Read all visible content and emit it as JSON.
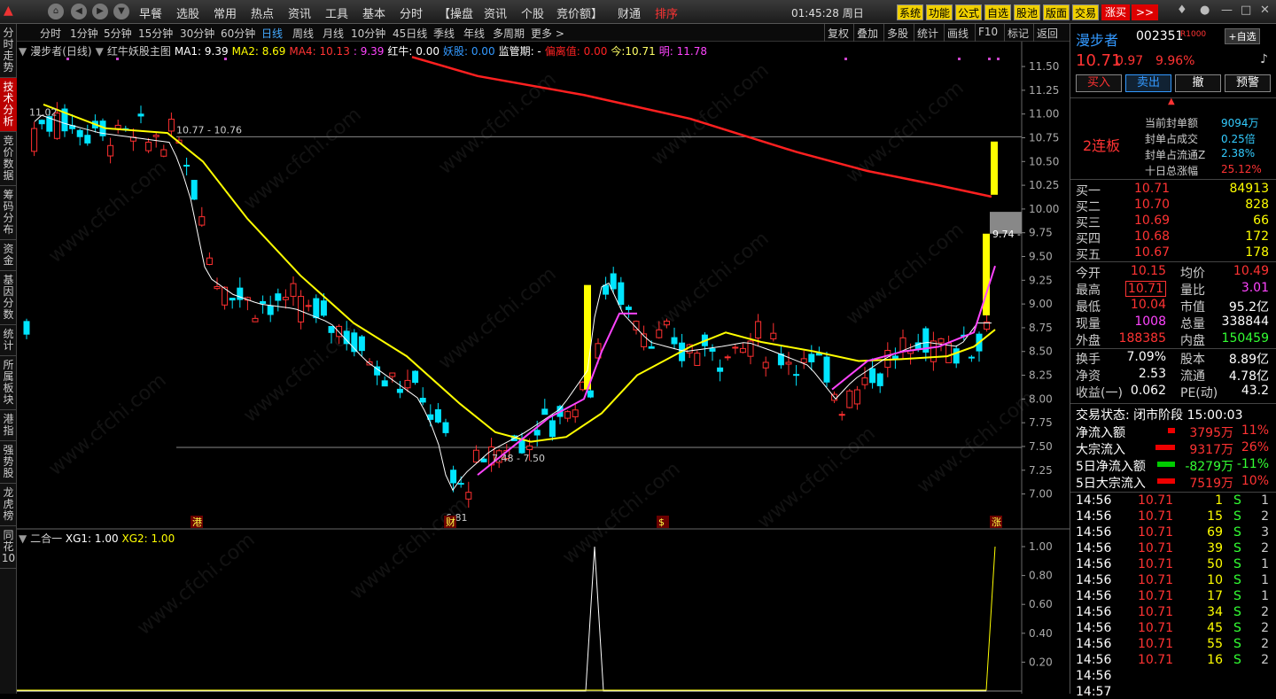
{
  "topbar": {
    "menus": [
      "早餐",
      "选股",
      "常用",
      "热点",
      "资讯",
      "工具",
      "基本",
      "分时",
      "【操盘",
      "资讯",
      "个股",
      "竞价额】",
      "财通",
      "排序"
    ],
    "time": "01:45:28 周日",
    "yellow_buttons": [
      "系统",
      "功能",
      "公式",
      "自选",
      "股池",
      "版面",
      "交易",
      "涨买"
    ],
    "more_button": ">>"
  },
  "leftbar": {
    "tabs": [
      "分时走势",
      "技术分析",
      "竞价数据",
      "筹码分布",
      "资金",
      "基因分数",
      "统计",
      "所属板块",
      "港指",
      "强势股",
      "龙虎榜",
      "同花10"
    ],
    "active_index": 1
  },
  "periods": {
    "items": [
      "分时",
      "1分钟",
      "5分钟",
      "15分钟",
      "30分钟",
      "60分钟",
      "日线",
      "周线",
      "月线",
      "10分钟",
      "45日线",
      "季线",
      "年线",
      "多周期",
      "更多 >"
    ],
    "selected_index": 6,
    "right_items": [
      "复权",
      "叠加",
      "多股",
      "统计",
      "画线",
      "F10",
      "标记",
      "返回"
    ]
  },
  "legend": {
    "title": "漫步者(日线)",
    "indicator": "红牛妖股主图",
    "ma1": "MA1: 9.39",
    "ma2": "MA2: 8.69",
    "ma4": "MA4: 10.13",
    "ma4b": ": 9.39",
    "hongniu": "红牛: 0.00",
    "yaogu": "妖股: 0.00",
    "jianguan": "监管期: -",
    "pianli": "偏离值: 0.00",
    "jin": "今:10.71",
    "ming": "明: 11.78",
    "colors": {
      "ma1": "#ffffff",
      "ma2": "#ffff00",
      "ma4": "#ff3333",
      "ma4b": "#ff44ff",
      "yaogu": "#3399ff",
      "pianli": "#ff2222",
      "jin": "#ffff66",
      "ming": "#ff44ff"
    }
  },
  "sublegend": {
    "name": "二合一",
    "xg1": "XG1: 1.00",
    "xg2": "XG2: 1.00"
  },
  "chart_annotations": {
    "high_label": "11.02",
    "low_label": "6.81",
    "range1": "10.77 - 10.76",
    "range2": "7.48 - 7.50",
    "price_tag": "9.74 -",
    "markers": [
      "港",
      "财",
      "$",
      "涨"
    ]
  },
  "chart_data": [
    {
      "type": "candlestick",
      "title": "漫步者(日线)",
      "y_ticks": [
        "11.50",
        "11.25",
        "11.00",
        "10.75",
        "10.50",
        "10.25",
        "10.00",
        "9.75",
        "9.50",
        "9.25",
        "9.00",
        "8.75",
        "8.50",
        "8.25",
        "8.00",
        "7.75",
        "7.50",
        "7.25",
        "7.00"
      ],
      "ylim": [
        6.8,
        11.65
      ],
      "last_close": 10.71,
      "high": 11.02,
      "low": 6.81,
      "hlines": [
        10.76,
        7.49
      ]
    },
    {
      "type": "line",
      "title": "二合一",
      "y_ticks": [
        "1.00",
        "0.80",
        "0.60",
        "0.40",
        "0.20"
      ],
      "ylim": [
        0,
        1.0
      ]
    }
  ],
  "quote": {
    "name": "漫步者",
    "code": "002351",
    "tag": "R1000",
    "self_select": "+自选",
    "price": "10.71",
    "change": "0.97",
    "pct": "9.96%",
    "buttons": [
      "买入",
      "卖出",
      "撤",
      "预警"
    ],
    "limit_label": "2连板",
    "limit_info": [
      {
        "k": "当前封单额",
        "v": "9094万"
      },
      {
        "k": "封单占成交",
        "v": "0.25倍"
      },
      {
        "k": "封单占流通Z",
        "v": "2.38%"
      },
      {
        "k": "十日总涨幅",
        "v": "25.12%"
      }
    ],
    "bids": [
      {
        "l": "买一",
        "p": "10.71",
        "v": "84913"
      },
      {
        "l": "买二",
        "p": "10.70",
        "v": "828"
      },
      {
        "l": "买三",
        "p": "10.69",
        "v": "66"
      },
      {
        "l": "买四",
        "p": "10.68",
        "v": "172"
      },
      {
        "l": "买五",
        "p": "10.67",
        "v": "178"
      }
    ],
    "stats1": [
      {
        "k1": "今开",
        "v1": "10.15",
        "k2": "均价",
        "v2": "10.49",
        "c1": "#f33",
        "c2": "#f33"
      },
      {
        "k1": "最高",
        "v1": "10.71",
        "k2": "量比",
        "v2": "3.01",
        "c1": "#f33",
        "c2": "#f4f"
      },
      {
        "k1": "最低",
        "v1": "10.04",
        "k2": "市值",
        "v2": "95.2亿",
        "c1": "#f33",
        "c2": "#fff"
      },
      {
        "k1": "现量",
        "v1": "1008",
        "k2": "总量",
        "v2": "338844",
        "c1": "#f4f",
        "c2": "#fff"
      },
      {
        "k1": "外盘",
        "v1": "188385",
        "k2": "内盘",
        "v2": "150459",
        "c1": "#f33",
        "c2": "#3f3"
      }
    ],
    "stats2": [
      {
        "k1": "换手",
        "v1": "7.09%",
        "k2": "股本",
        "v2": "8.89亿"
      },
      {
        "k1": "净资",
        "v1": "2.53",
        "k2": "流通",
        "v2": "4.78亿"
      },
      {
        "k1": "收益(一)",
        "v1": "0.062",
        "k2": "PE(动)",
        "v2": "43.2"
      }
    ],
    "trade_status": "交易状态: 闭市阶段 15:00:03",
    "flows": [
      {
        "k": "净流入额",
        "v": "3795万",
        "p": "11%",
        "c": "#e00",
        "w": 8
      },
      {
        "k": "大宗流入",
        "v": "9317万",
        "p": "26%",
        "c": "#e00",
        "w": 22
      },
      {
        "k": "5日净流入额",
        "v": "-8279万",
        "p": "-11%",
        "c": "#0c0",
        "w": 20
      },
      {
        "k": "5日大宗流入",
        "v": "7519万",
        "p": "10%",
        "c": "#e00",
        "w": 20
      }
    ],
    "ticks": [
      {
        "t": "14:56",
        "p": "10.71",
        "v": "1",
        "s": "S",
        "n": "1"
      },
      {
        "t": "14:56",
        "p": "10.71",
        "v": "15",
        "s": "S",
        "n": "2"
      },
      {
        "t": "14:56",
        "p": "10.71",
        "v": "69",
        "s": "S",
        "n": "3"
      },
      {
        "t": "14:56",
        "p": "10.71",
        "v": "39",
        "s": "S",
        "n": "2"
      },
      {
        "t": "14:56",
        "p": "10.71",
        "v": "50",
        "s": "S",
        "n": "1"
      },
      {
        "t": "14:56",
        "p": "10.71",
        "v": "10",
        "s": "S",
        "n": "1"
      },
      {
        "t": "14:56",
        "p": "10.71",
        "v": "17",
        "s": "S",
        "n": "1"
      },
      {
        "t": "14:56",
        "p": "10.71",
        "v": "34",
        "s": "S",
        "n": "2"
      },
      {
        "t": "14:56",
        "p": "10.71",
        "v": "45",
        "s": "S",
        "n": "2"
      },
      {
        "t": "14:56",
        "p": "10.71",
        "v": "55",
        "s": "S",
        "n": "2"
      },
      {
        "t": "14:56",
        "p": "10.71",
        "v": "16",
        "s": "S",
        "n": "2"
      },
      {
        "t": "14:56",
        "p": "",
        "v": "",
        "s": "",
        "n": ""
      },
      {
        "t": "14:57",
        "p": "",
        "v": "",
        "s": "",
        "n": ""
      }
    ]
  },
  "watermark": "www.cfchi.com"
}
